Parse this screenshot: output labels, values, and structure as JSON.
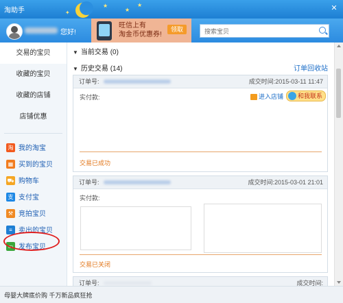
{
  "window": {
    "title": "淘助手",
    "close_glyph": "✕"
  },
  "header": {
    "greeting": "您好!",
    "promo_line1": "旺信上有",
    "promo_line2": "淘金币优惠券!",
    "promo_button": "领取",
    "search_placeholder": "搜索宝贝"
  },
  "sidebar": {
    "nav": [
      {
        "label": "交易的宝贝",
        "active": true
      },
      {
        "label": "收藏的宝贝",
        "active": false
      },
      {
        "label": "收藏的店铺",
        "active": false
      },
      {
        "label": "店铺优惠",
        "active": false
      }
    ],
    "apps": [
      {
        "label": "我的淘宝",
        "icon": "taobao-icon",
        "color": "#f25a1e",
        "glyph": "淘"
      },
      {
        "label": "买到的宝贝",
        "icon": "bought-items-icon",
        "color": "#f27c1e",
        "glyph": "▦"
      },
      {
        "label": "购物车",
        "icon": "cart-icon",
        "color": "#f5a623",
        "glyph": "⛟"
      },
      {
        "label": "支付宝",
        "icon": "alipay-icon",
        "color": "#1e88e5",
        "glyph": "支"
      },
      {
        "label": "竞拍宝贝",
        "icon": "auction-hammer-icon",
        "color": "#f08a24",
        "glyph": "⚒"
      },
      {
        "label": "卖出的宝贝",
        "icon": "sold-items-icon",
        "color": "#1e7fd4",
        "glyph": "≡"
      },
      {
        "label": "发布宝贝",
        "icon": "publish-icon",
        "color": "#3aa63a",
        "glyph": "▭"
      }
    ]
  },
  "main": {
    "current_orders": "当前交易",
    "current_count": "(0)",
    "history_orders": "历史交易",
    "history_count": "(14)",
    "recycle_link": "订单回收站",
    "orders": [
      {
        "order_label": "订单号:",
        "time": "成交时间:2015-03-11 11:47",
        "paid_label": "实付款:",
        "shop_link": "进入店铺",
        "contact_button": "和我联系",
        "status": "交易已成功"
      },
      {
        "order_label": "订单号:",
        "time": "成交时间:2015-03-01 21:01",
        "paid_label": "实付款:",
        "status": "交易已关闭"
      },
      {
        "order_label": "订单号:",
        "time": "成交时间:"
      }
    ]
  },
  "statusbar": {
    "promo_text": "母婴大牌底价购 千万新品疯狂抢"
  }
}
